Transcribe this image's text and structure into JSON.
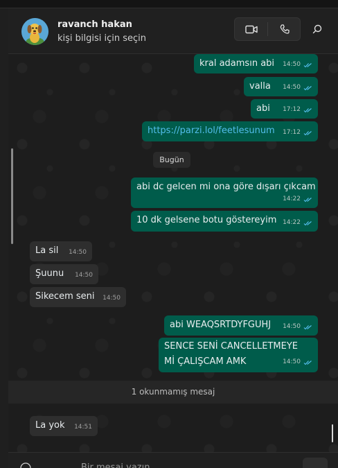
{
  "header": {
    "contact_name": "ravanch hakan",
    "contact_subtitle": "kişi bilgisi için seçin",
    "icons": [
      "video-call-icon",
      "voice-call-icon",
      "search-icon"
    ]
  },
  "chat": {
    "messages": [
      {
        "dir": "out",
        "text": "kral adamsın abi",
        "time": "14:50"
      },
      {
        "dir": "out",
        "text": "valla",
        "time": "14:50"
      },
      {
        "dir": "out",
        "text": "abi",
        "time": "17:12"
      },
      {
        "dir": "out",
        "text": "https://parzi.lol/feetlesunum",
        "time": "17:12"
      },
      {
        "dir": "out",
        "text": "abi dc gelcen mi ona göre dışarı çıkcam",
        "time": "14:22"
      },
      {
        "dir": "out",
        "text": "10 dk gelsene botu göstereyim",
        "time": "14:22"
      },
      {
        "dir": "in",
        "text": "La sil",
        "time": "14:50"
      },
      {
        "dir": "in",
        "text": "Şuunu",
        "time": "14:50"
      },
      {
        "dir": "in",
        "text": "Sikecem seni",
        "time": "14:50"
      },
      {
        "dir": "out",
        "text": "abi WEAQSRTDYFGUHJ",
        "time": "14:50"
      },
      {
        "dir": "out",
        "text": "SENCE SENİ CANCELLETMEYE Mİ ÇALIŞCAM AMK",
        "time": "14:50"
      },
      {
        "dir": "in",
        "text": "La yok",
        "time": "14:51"
      }
    ],
    "date_separator": "Bugün",
    "unread_banner": "1 okunmamış mesaj"
  },
  "composer": {
    "placeholder": "Bir mesaj yazın"
  },
  "colors": {
    "outgoing_bubble": "#005c4b",
    "incoming_bubble": "#2e2e2e",
    "read_tick": "#53bdeb",
    "link": "#53bdeb"
  }
}
